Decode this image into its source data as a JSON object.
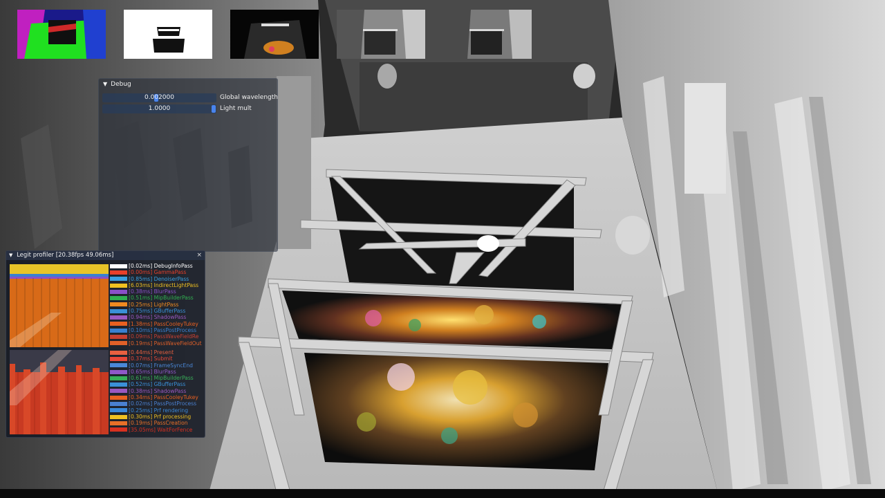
{
  "debug_panel": {
    "title": "Debug",
    "sliders": [
      {
        "value": "0.002000",
        "label": "Global wavelength"
      },
      {
        "value": "1.0000",
        "label": "Light mult"
      }
    ]
  },
  "profiler": {
    "title": "Legit profiler [20.38fps   49.06ms]",
    "close": "×",
    "cpu_entries": [
      {
        "text": "[0.02ms] DebugInfoPass",
        "color": "#ffffff"
      },
      {
        "text": "[0.00ms] GammaPass",
        "color": "#e8402a"
      },
      {
        "text": "[0.85ms] DenoiserPass",
        "color": "#3aa0e0"
      },
      {
        "text": "[6.03ms] IndirectLightPass",
        "color": "#f0c020"
      },
      {
        "text": "[0.38ms] BlurPass",
        "color": "#8a50c8"
      },
      {
        "text": "[0.51ms] MipBuilderPass",
        "color": "#30b050"
      },
      {
        "text": "[0.25ms] LightPass",
        "color": "#f08a20"
      },
      {
        "text": "[0.75ms] GBufferPass",
        "color": "#3a90d8"
      },
      {
        "text": "[0.94ms] ShadowPass",
        "color": "#9a58c0"
      },
      {
        "text": "[1.38ms] PassCooleyTukey",
        "color": "#e86020"
      },
      {
        "text": "[0.10ms] PassPostProcess",
        "color": "#3a80d0"
      },
      {
        "text": "[0.09ms] PassWaveFieldRe",
        "color": "#c84030"
      },
      {
        "text": "[0.19ms] PassWaveFieldOut",
        "color": "#e06028"
      }
    ],
    "gpu_entries": [
      {
        "text": "[0.44ms] Present",
        "color": "#e86040"
      },
      {
        "text": "[0.37ms] Submit",
        "color": "#e84838"
      },
      {
        "text": "[0.07ms] FrameSyncEnd",
        "color": "#4a88d8"
      },
      {
        "text": "[0.65ms] BlurPass",
        "color": "#9058c8"
      },
      {
        "text": "[0.61ms] MipBuilderPass",
        "color": "#38b058"
      },
      {
        "text": "[0.52ms] GBufferPass",
        "color": "#3a90d8"
      },
      {
        "text": "[0.38ms] ShadowPass",
        "color": "#9a58c0"
      },
      {
        "text": "[0.34ms] PassCooleyTukey",
        "color": "#e86020"
      },
      {
        "text": "[0.02ms] PassPostProcess",
        "color": "#4a80d0"
      },
      {
        "text": "[0.25ms] Prf rendering",
        "color": "#3a88d8"
      },
      {
        "text": "[0.30ms] Prf processing",
        "color": "#f0c020"
      },
      {
        "text": "[0.19ms] PassCreation",
        "color": "#e87028"
      },
      {
        "text": "[35.05ms] WaitForFence",
        "color": "#d83020"
      }
    ]
  },
  "thumbnails": [
    {
      "name": "normals-buffer"
    },
    {
      "name": "mask-buffer"
    },
    {
      "name": "lighting-buffer"
    },
    {
      "name": "ao-buffer"
    },
    {
      "name": "final-buffer"
    }
  ],
  "colors": {
    "slider_grab": "#4d8cff",
    "slider_track": "#283c5a",
    "panel_bg": "#20263280"
  }
}
